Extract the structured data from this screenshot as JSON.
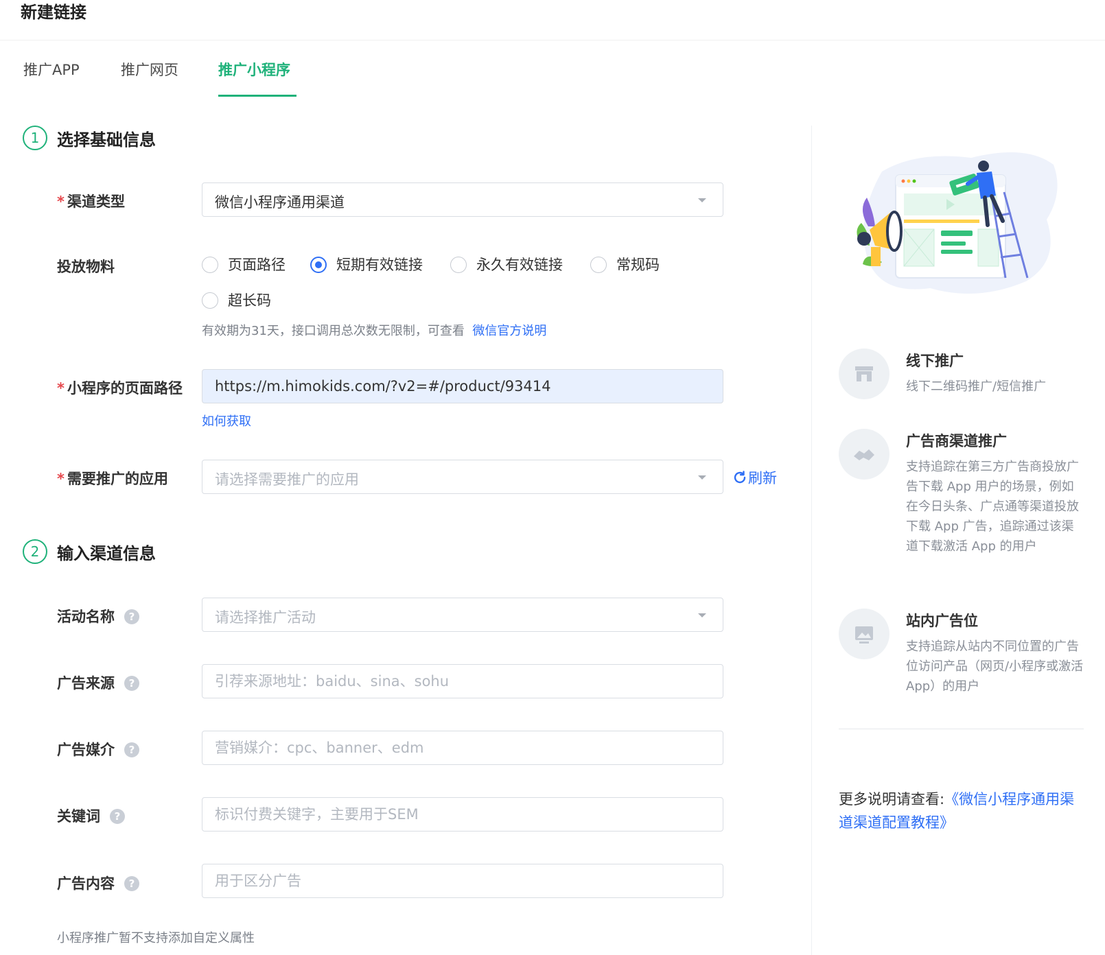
{
  "header": {
    "title": "新建链接"
  },
  "tabs": [
    {
      "label": "推广APP"
    },
    {
      "label": "推广网页"
    },
    {
      "label": "推广小程序"
    }
  ],
  "section1": {
    "number": "1",
    "title": "选择基础信息",
    "channel_type": {
      "label": "渠道类型",
      "value": "微信小程序通用渠道"
    },
    "material": {
      "label": "投放物料",
      "options": [
        "页面路径",
        "短期有效链接",
        "永久有效链接",
        "常规码",
        "超长码"
      ],
      "selected": "短期有效链接",
      "hint": "有效期为31天，接口调用总次数无限制，可查看",
      "hint_link": "微信官方说明"
    },
    "page_path": {
      "label": "小程序的页面路径",
      "value": "https://m.himokids.com/?v2=#/product/93414",
      "help_link": "如何获取"
    },
    "app": {
      "label": "需要推广的应用",
      "placeholder": "请选择需要推广的应用",
      "refresh": "刷新"
    }
  },
  "section2": {
    "number": "2",
    "title": "输入渠道信息",
    "fields": [
      {
        "label": "活动名称",
        "placeholder": "请选择推广活动"
      },
      {
        "label": "广告来源",
        "placeholder": "引荐来源地址：baidu、sina、sohu"
      },
      {
        "label": "广告媒介",
        "placeholder": "营销媒介：cpc、banner、edm"
      },
      {
        "label": "关键词",
        "placeholder": "标识付费关键字，主要用于SEM"
      },
      {
        "label": "广告内容",
        "placeholder": "用于区分广告"
      }
    ],
    "help_mark": "?",
    "note": "小程序推广暂不支持添加自定义属性"
  },
  "sidebar": {
    "items": [
      {
        "title": "线下推广",
        "desc": "线下二维码推广/短信推广",
        "icon": "store-icon"
      },
      {
        "title": "广告商渠道推广",
        "desc": "支持追踪在第三方广告商投放广告下载 App 用户的场景，例如在今日头条、广点通等渠道投放下载 App 广告，追踪通过该渠道下载激活 App 的用户",
        "icon": "handshake-icon"
      },
      {
        "title": "站内广告位",
        "desc": "支持追踪从站内不同位置的广告位访问产品（网页/小程序或激活 App）的用户",
        "icon": "picture-icon"
      }
    ],
    "more_prefix": "更多说明请查看:",
    "more_link": "《微信小程序通用渠道渠道配置教程》"
  },
  "colors": {
    "accent": "#1fb27a",
    "link": "#2f6ff5",
    "required": "#e5484d"
  }
}
